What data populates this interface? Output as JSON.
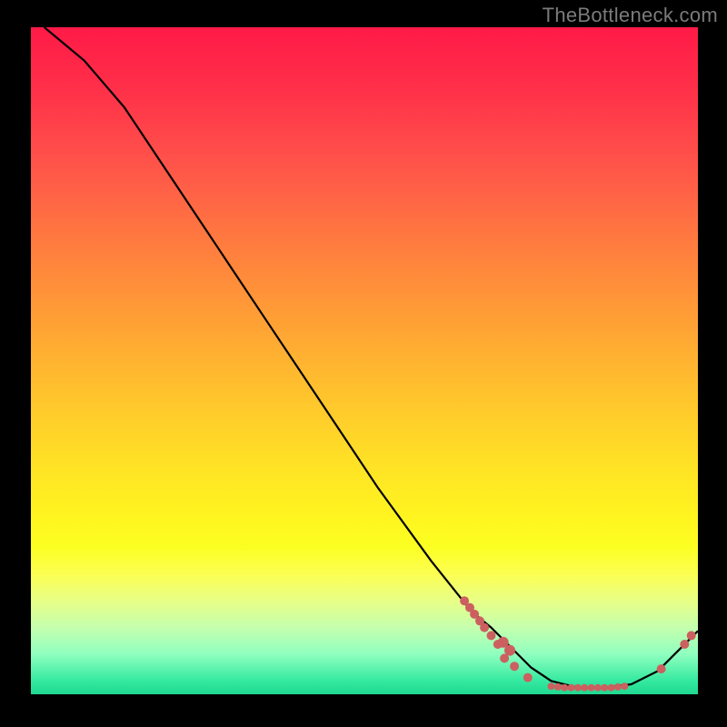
{
  "watermark": "TheBottleneck.com",
  "colors": {
    "top": "#ff1a47",
    "mid": "#ffe325",
    "bottom": "#20d890",
    "marker": "#cc6060",
    "curve": "#000000",
    "bg": "#000000"
  },
  "chart_data": {
    "type": "line",
    "title": "",
    "xlabel": "",
    "ylabel": "",
    "xlim": [
      0,
      100
    ],
    "ylim": [
      0,
      100
    ],
    "annotations": [
      "TheBottleneck.com"
    ],
    "curve": [
      {
        "x": 2,
        "y": 100
      },
      {
        "x": 8,
        "y": 95
      },
      {
        "x": 14,
        "y": 88
      },
      {
        "x": 20,
        "y": 79
      },
      {
        "x": 28,
        "y": 67
      },
      {
        "x": 36,
        "y": 55
      },
      {
        "x": 44,
        "y": 43
      },
      {
        "x": 52,
        "y": 31
      },
      {
        "x": 60,
        "y": 20
      },
      {
        "x": 66,
        "y": 12.5
      },
      {
        "x": 69,
        "y": 10
      },
      {
        "x": 72,
        "y": 7
      },
      {
        "x": 75,
        "y": 4
      },
      {
        "x": 78,
        "y": 2
      },
      {
        "x": 82,
        "y": 1
      },
      {
        "x": 86,
        "y": 1
      },
      {
        "x": 90,
        "y": 1.5
      },
      {
        "x": 94,
        "y": 3.5
      },
      {
        "x": 97,
        "y": 6.5
      },
      {
        "x": 100,
        "y": 9.5
      }
    ],
    "markers": [
      {
        "x": 65.0,
        "y": 14.0,
        "r": 5
      },
      {
        "x": 65.8,
        "y": 13.0,
        "r": 5
      },
      {
        "x": 66.5,
        "y": 12.0,
        "r": 5
      },
      {
        "x": 67.3,
        "y": 11.0,
        "r": 5
      },
      {
        "x": 68.0,
        "y": 10.0,
        "r": 5
      },
      {
        "x": 69.0,
        "y": 8.8,
        "r": 5
      },
      {
        "x": 70.0,
        "y": 7.5,
        "r": 5
      },
      {
        "x": 70.8,
        "y": 7.8,
        "r": 6
      },
      {
        "x": 71.8,
        "y": 6.6,
        "r": 6
      },
      {
        "x": 71.0,
        "y": 5.4,
        "r": 5
      },
      {
        "x": 72.5,
        "y": 4.2,
        "r": 5
      },
      {
        "x": 74.5,
        "y": 2.5,
        "r": 5
      },
      {
        "x": 78.0,
        "y": 1.2,
        "r": 4
      },
      {
        "x": 79.0,
        "y": 1.1,
        "r": 4
      },
      {
        "x": 80.0,
        "y": 1.0,
        "r": 4
      },
      {
        "x": 81.0,
        "y": 1.0,
        "r": 4
      },
      {
        "x": 82.0,
        "y": 1.0,
        "r": 4
      },
      {
        "x": 83.0,
        "y": 1.0,
        "r": 4
      },
      {
        "x": 84.0,
        "y": 1.0,
        "r": 4
      },
      {
        "x": 85.0,
        "y": 1.0,
        "r": 4
      },
      {
        "x": 86.0,
        "y": 1.0,
        "r": 4
      },
      {
        "x": 87.0,
        "y": 1.0,
        "r": 4
      },
      {
        "x": 88.0,
        "y": 1.1,
        "r": 4
      },
      {
        "x": 89.0,
        "y": 1.2,
        "r": 4
      },
      {
        "x": 94.5,
        "y": 3.8,
        "r": 5
      },
      {
        "x": 98.0,
        "y": 7.5,
        "r": 5
      },
      {
        "x": 99.0,
        "y": 8.8,
        "r": 5
      }
    ]
  }
}
